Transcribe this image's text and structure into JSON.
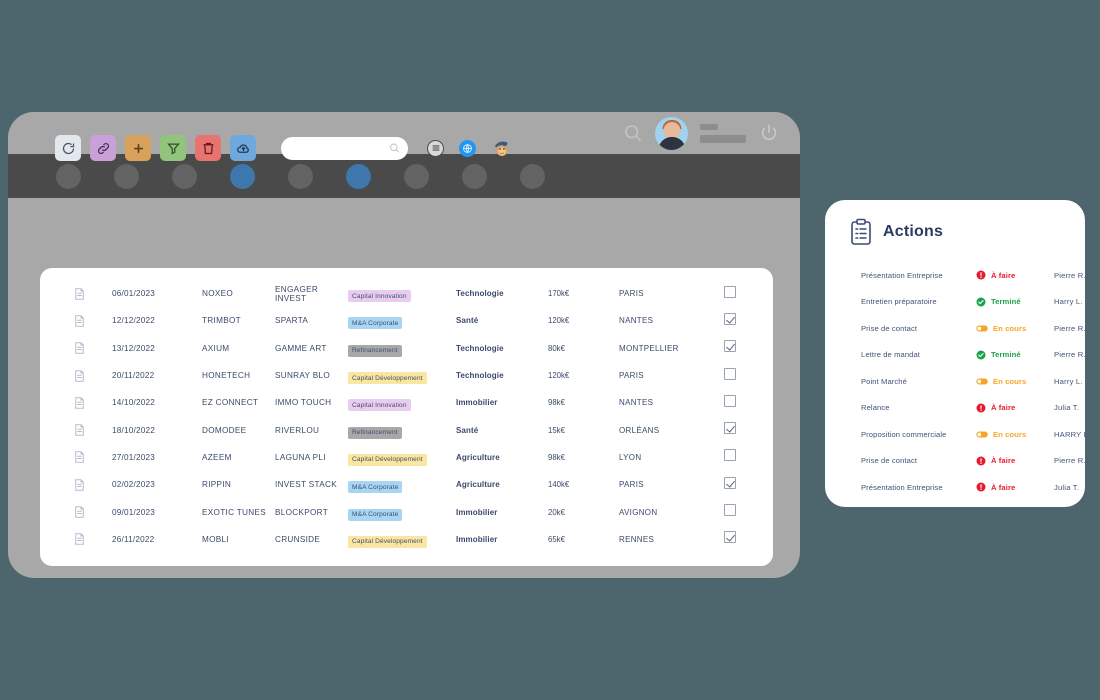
{
  "theme": {
    "page_bg": "#4d666e",
    "window_frame": "#a8a8a8",
    "nav_bar": "#4a4a4a",
    "nav_active": "#3d77ad",
    "card_bg": "#ffffff",
    "text_primary": "#3b4a6b",
    "delete_red": "#f2566d",
    "status_todo": "#e8192c",
    "status_done": "#1aa34a",
    "status_progress": "#f5a623",
    "accent_blue": "#2196f3"
  },
  "window": {
    "header": {
      "search_icon": "search-icon",
      "power_icon": "power-icon",
      "user_name_placeholder": "",
      "user_role_placeholder": ""
    },
    "nav": {
      "items": [
        {
          "id": "nav-1",
          "active": false
        },
        {
          "id": "nav-2",
          "active": false
        },
        {
          "id": "nav-3",
          "active": false
        },
        {
          "id": "nav-4",
          "active": true
        },
        {
          "id": "nav-5",
          "active": false
        },
        {
          "id": "nav-6",
          "active": true
        },
        {
          "id": "nav-7",
          "active": false
        },
        {
          "id": "nav-8",
          "active": false
        },
        {
          "id": "nav-9",
          "active": false
        }
      ]
    }
  },
  "toolbar": {
    "buttons": [
      {
        "name": "refresh-button",
        "icon": "refresh-icon",
        "bg": "#e3e8ec",
        "stroke": "#4a5568"
      },
      {
        "name": "link-button",
        "icon": "link-icon",
        "bg": "#c9a0d8",
        "stroke": "#4a3555"
      },
      {
        "name": "add-button",
        "icon": "plus-icon",
        "bg": "#d9a25c",
        "stroke": "#5a4020"
      },
      {
        "name": "filter-button",
        "icon": "funnel-icon",
        "bg": "#93c47d",
        "stroke": "#33502a"
      },
      {
        "name": "delete-button",
        "icon": "trash-icon",
        "bg": "#e8736f",
        "stroke": "#5e2220"
      },
      {
        "name": "cloud-upload-button",
        "icon": "cloud-upload-icon",
        "bg": "#6fa8dc",
        "stroke": "#1d3c5c"
      }
    ],
    "search": {
      "value": "",
      "placeholder": "",
      "icon": "search-icon"
    },
    "right_icons": [
      {
        "name": "list-view-icon",
        "icon": "hamburger-list-icon"
      },
      {
        "name": "globe-icon",
        "icon": "globe-icon"
      },
      {
        "name": "mailchimp-icon",
        "icon": "monkey-icon"
      }
    ]
  },
  "table": {
    "columns": [
      "icon",
      "date",
      "client",
      "project",
      "category",
      "sector",
      "amount",
      "city",
      "checked",
      "delete"
    ],
    "rows": [
      {
        "icon": "document-icon",
        "date": "06/01/2023",
        "client": "NOXEO",
        "project": "ENGAGER INVEST",
        "category": "Capital Innovation",
        "cat_bg": "#e8cdf0",
        "sector": "Technologie",
        "amount": "170k€",
        "city": "PARIS",
        "checked": false,
        "delete": "delete-icon"
      },
      {
        "icon": "document-icon",
        "date": "12/12/2022",
        "client": "TRIMBOT",
        "project": "SPARTA",
        "category": "M&A Corporate",
        "cat_bg": "#a8d5f2",
        "sector": "Santé",
        "amount": "120k€",
        "city": "NANTES",
        "checked": true,
        "delete": "delete-icon"
      },
      {
        "icon": "document-icon",
        "date": "13/12/2022",
        "client": "AXIUM",
        "project": "GAMME ART",
        "category": "Refinancement",
        "cat_bg": "#a8a8a8",
        "sector": "Technologie",
        "amount": "80k€",
        "city": "MONTPELLIER",
        "checked": true,
        "delete": "delete-icon"
      },
      {
        "icon": "document-icon",
        "date": "20/11/2022",
        "client": "HONETECH",
        "project": "SUNRAY BLO",
        "category": "Capital Développement",
        "cat_bg": "#fae6a0",
        "sector": "Technologie",
        "amount": "120k€",
        "city": "PARIS",
        "checked": false,
        "delete": "delete-icon"
      },
      {
        "icon": "document-icon",
        "date": "14/10/2022",
        "client": "EZ CONNECT",
        "project": "IMMO TOUCH",
        "category": "Capital Innovation",
        "cat_bg": "#e8cdf0",
        "sector": "Immobilier",
        "amount": "98k€",
        "city": "NANTES",
        "checked": false,
        "delete": "delete-icon"
      },
      {
        "icon": "document-icon",
        "date": "18/10/2022",
        "client": "DOMODEE",
        "project": "RIVERLOU",
        "category": "Refinancement",
        "cat_bg": "#a8a8a8",
        "sector": "Santé",
        "amount": "15k€",
        "city": "ORLÉANS",
        "checked": true,
        "delete": "delete-icon"
      },
      {
        "icon": "document-icon",
        "date": "27/01/2023",
        "client": "AZEEM",
        "project": "LAGUNA PLI",
        "category": "Capital Développement",
        "cat_bg": "#fae6a0",
        "sector": "Agriculture",
        "amount": "98k€",
        "city": "LYON",
        "checked": false,
        "delete": "delete-icon"
      },
      {
        "icon": "document-icon",
        "date": "02/02/2023",
        "client": "RIPPIN",
        "project": "INVEST STACK",
        "category": "M&A Corporate",
        "cat_bg": "#a8d5f2",
        "sector": "Agriculture",
        "amount": "140k€",
        "city": "PARIS",
        "checked": true,
        "delete": "delete-icon"
      },
      {
        "icon": "document-icon",
        "date": "09/01/2023",
        "client": "EXOTIC TUNES",
        "project": "BLOCKPORT",
        "category": "M&A Corporate",
        "cat_bg": "#a8d5f2",
        "sector": "Immobilier",
        "amount": "20k€",
        "city": "AVIGNON",
        "checked": false,
        "delete": "delete-icon"
      },
      {
        "icon": "document-icon",
        "date": "26/11/2022",
        "client": "MOBLI",
        "project": "CRUNSIDE",
        "category": "Capital Développement",
        "cat_bg": "#fae6a0",
        "sector": "Immobilier",
        "amount": "65k€",
        "city": "RENNES",
        "checked": true,
        "delete": "delete-icon"
      }
    ]
  },
  "actions": {
    "title": "Actions",
    "icon": "clipboard-checklist-icon",
    "rows": [
      {
        "label": "Présentation Entreprise",
        "status": "À faire",
        "status_key": "todo",
        "owner": "Pierre R.",
        "checked": true
      },
      {
        "label": "Entretien préparatoire",
        "status": "Terminé",
        "status_key": "done",
        "owner": "Harry L.",
        "checked": false
      },
      {
        "label": "Prise de contact",
        "status": "En cours",
        "status_key": "progress",
        "owner": "Pierre R.",
        "checked": true
      },
      {
        "label": "Lettre de mandat",
        "status": "Terminé",
        "status_key": "done",
        "owner": "Pierre R.",
        "checked": false
      },
      {
        "label": "Point Marché",
        "status": "En cours",
        "status_key": "progress",
        "owner": "Harry L.",
        "checked": true
      },
      {
        "label": "Relance",
        "status": "À faire",
        "status_key": "todo",
        "owner": "Julia T.",
        "checked": true
      },
      {
        "label": "Proposition commerciale",
        "status": "En cours",
        "status_key": "progress",
        "owner": "HARRY L.",
        "checked": false
      },
      {
        "label": "Prise de contact",
        "status": "À faire",
        "status_key": "todo",
        "owner": "Pierre R.",
        "checked": true
      },
      {
        "label": "Présentation Entreprise",
        "status": "À faire",
        "status_key": "todo",
        "owner": "Julia T.",
        "checked": false
      }
    ]
  }
}
